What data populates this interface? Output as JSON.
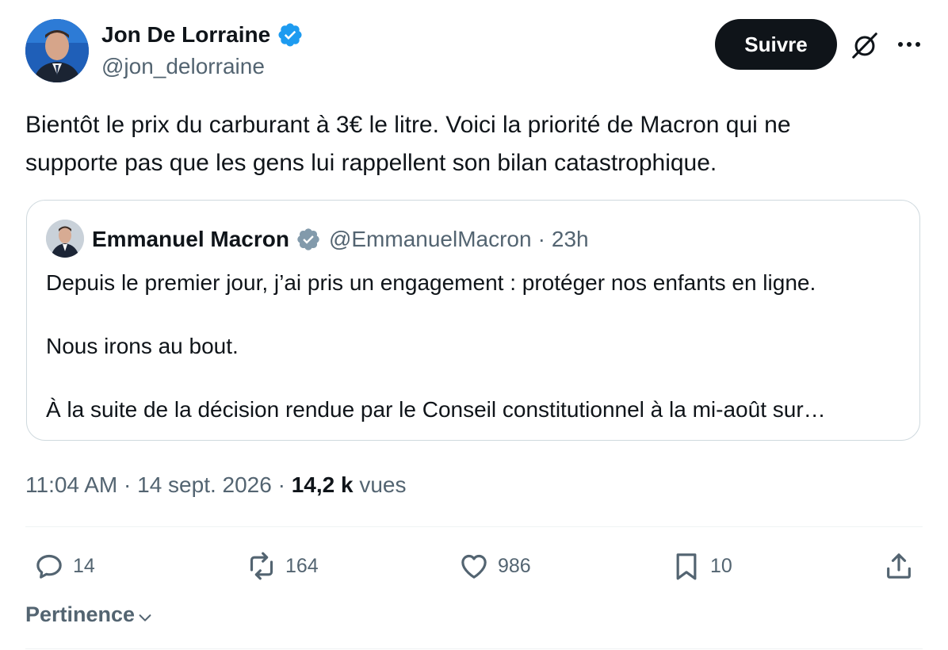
{
  "author": {
    "name": "Jon De Lorraine",
    "handle": "@jon_delorraine",
    "verified_color": "#1d9bf0"
  },
  "header": {
    "follow_label": "Suivre",
    "grok_icon": "grok-icon",
    "more_icon": "more-icon"
  },
  "tweet": {
    "text_line1": "Bientôt le prix du carburant à 3€ le litre. Voici la priorité de Macron qui ne",
    "text_line2": "supporte pas que les gens lui rappellent son bilan catastrophique."
  },
  "quote": {
    "name": "Emmanuel Macron",
    "verified_color": "#829aab",
    "handle": "@EmmanuelMacron",
    "separator": "·",
    "time": "23h",
    "line1": "Depuis le premier jour, j’ai pris un engagement : protéger nos enfants en ligne.",
    "line2": "Nous irons au bout.",
    "line3": "À la suite de la décision rendue par le Conseil constitutionnel à la mi-août sur…"
  },
  "meta": {
    "time": "11:04 AM",
    "separator": "·",
    "date": "14 sept. 2026",
    "views_count": "14,2 k",
    "views_label": "vues"
  },
  "actions": {
    "replies": "14",
    "reposts": "164",
    "likes": "986",
    "bookmarks": "10"
  },
  "sort": {
    "label": "Pertinence"
  },
  "colors": {
    "text": "#0f1419",
    "secondary": "#536471",
    "border": "#cfd9de",
    "divider": "#eff3f4",
    "button_bg": "#0f1419"
  }
}
